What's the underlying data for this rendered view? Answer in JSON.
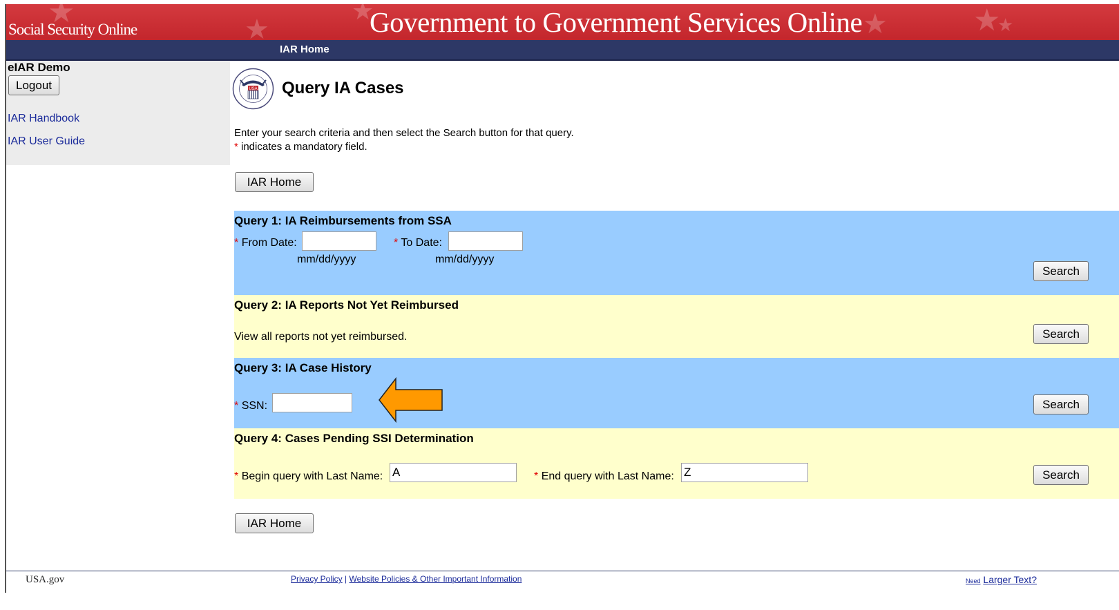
{
  "header": {
    "brand": "Social Security Online",
    "title": "Government to Government Services Online",
    "nav_link": "IAR Home"
  },
  "sidebar": {
    "title": "eIAR Demo",
    "logout_label": "Logout",
    "links": [
      "IAR Handbook",
      "IAR User Guide"
    ]
  },
  "page": {
    "seal_icon": "ssa-seal-icon",
    "seal_text": "USA",
    "title": "Query IA Cases",
    "instruction": "Enter your search criteria and then select the Search button for that query.",
    "required_mark": "*",
    "required_note": " indicates a mandatory field.",
    "home_button": "IAR Home"
  },
  "queries": {
    "q1": {
      "title": "Query 1: IA Reimbursements from SSA",
      "from_label": "From Date:",
      "from_value": "",
      "to_label": "To Date:",
      "to_value": "",
      "from_hint": "mm/dd/yyyy",
      "to_hint": "mm/dd/yyyy",
      "search_label": "Search"
    },
    "q2": {
      "title": "Query 2: IA Reports Not Yet Reimbursed",
      "description": "View all reports not yet reimbursed.",
      "search_label": "Search"
    },
    "q3": {
      "title": "Query 3: IA Case History",
      "ssn_label": "SSN:",
      "ssn_value": "",
      "search_label": "Search"
    },
    "q4": {
      "title": "Query 4: Cases Pending SSI Determination",
      "begin_label": "Begin query with Last Name:",
      "begin_value": "A",
      "end_label": "End query with Last Name:",
      "end_value": "Z",
      "search_label": "Search"
    }
  },
  "annotation": {
    "arrow_color": "#ff9900",
    "arrow_icon": "pointer-arrow-icon"
  },
  "footer": {
    "usagov": "USA.gov",
    "privacy": "Privacy Policy",
    "separator": "|",
    "policies": "Website Policies & Other Important Information",
    "need": "Need",
    "larger_text": "Larger Text?"
  },
  "colors": {
    "banner_red": "#c3262c",
    "nav_blue": "#2d3866",
    "panel_blue": "#99ccff",
    "panel_yellow": "#ffffcc",
    "required_red": "#e00000"
  }
}
